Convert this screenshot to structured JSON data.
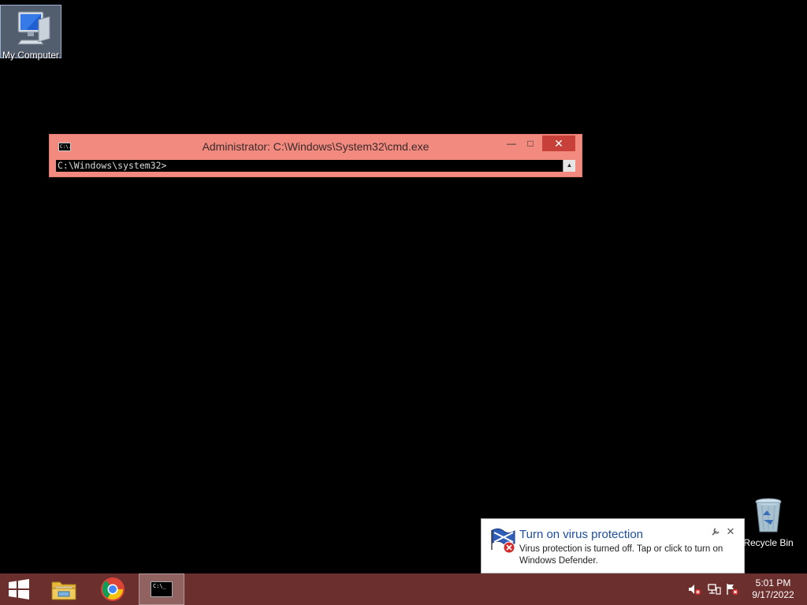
{
  "desktop": {
    "icons": [
      {
        "label": "My Computer"
      },
      {
        "label": "Recycle Bin"
      }
    ]
  },
  "cmd_window": {
    "title": "Administrator: C:\\Windows\\System32\\cmd.exe",
    "prompt": "C:\\Windows\\system32>",
    "minimize_glyph": "—",
    "maximize_glyph": "□",
    "close_glyph": "✕",
    "icon_text": "C:\\."
  },
  "notification": {
    "title": "Turn on virus protection",
    "message": "Virus protection is turned off. Tap or click to turn on Windows Defender.",
    "close_glyph": "✕"
  },
  "taskbar": {
    "cmd_thumb_text": "C:\\_",
    "clock": {
      "time": "5:01 PM",
      "date": "9/17/2022"
    }
  },
  "colors": {
    "cmd_titlebar": "#f38a80",
    "close_button": "#c7403a",
    "taskbar": "#6b2f2d",
    "notification_title": "#1d4fa3"
  }
}
